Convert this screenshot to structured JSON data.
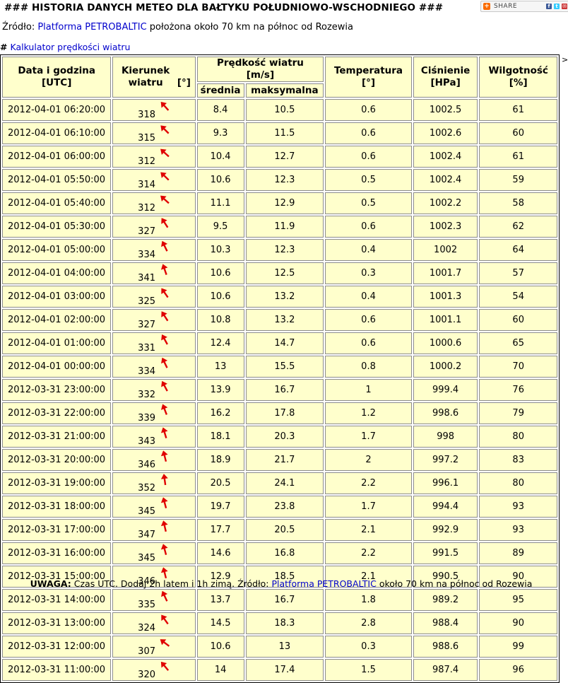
{
  "header": {
    "title": "### HISTORIA DANYCH METEO DLA BAŁTYKU POŁUDNIOWO-WSCHODNIEGO ###",
    "share_label": "SHARE"
  },
  "source": {
    "prefix": "Źródło:",
    "link": "Platforma PETROBALTIC",
    "suffix": "położona około 70 km na północ od Rozewia"
  },
  "calculator": {
    "hash": "#",
    "link": "Kalkulator prędkości wiatru"
  },
  "table": {
    "headers": {
      "datetime": "Data i godzina",
      "datetime_unit": "[UTC]",
      "direction": "Kierunek wiatru",
      "direction_unit": "[°]",
      "speed": "Prędkość wiatru",
      "speed_unit": "[m/s]",
      "speed_avg": "średnia",
      "speed_max": "maksymalna",
      "temperature": "Temperatura",
      "temperature_unit": "[°]",
      "pressure": "Ciśnienie",
      "pressure_unit": "[HPa]",
      "humidity": "Wilgotność",
      "humidity_unit": "[%]"
    },
    "rows": [
      {
        "dt": "2012-04-01 06:20:00",
        "dir": "318",
        "avg": "8.4",
        "max": "10.5",
        "temp": "0.6",
        "press": "1002.5",
        "hum": "61"
      },
      {
        "dt": "2012-04-01 06:10:00",
        "dir": "315",
        "avg": "9.3",
        "max": "11.5",
        "temp": "0.6",
        "press": "1002.6",
        "hum": "60"
      },
      {
        "dt": "2012-04-01 06:00:00",
        "dir": "312",
        "avg": "10.4",
        "max": "12.7",
        "temp": "0.6",
        "press": "1002.4",
        "hum": "61"
      },
      {
        "dt": "2012-04-01 05:50:00",
        "dir": "314",
        "avg": "10.6",
        "max": "12.3",
        "temp": "0.5",
        "press": "1002.4",
        "hum": "59"
      },
      {
        "dt": "2012-04-01 05:40:00",
        "dir": "312",
        "avg": "11.1",
        "max": "12.9",
        "temp": "0.5",
        "press": "1002.2",
        "hum": "58"
      },
      {
        "dt": "2012-04-01 05:30:00",
        "dir": "327",
        "avg": "9.5",
        "max": "11.9",
        "temp": "0.6",
        "press": "1002.3",
        "hum": "62"
      },
      {
        "dt": "2012-04-01 05:00:00",
        "dir": "334",
        "avg": "10.3",
        "max": "12.3",
        "temp": "0.4",
        "press": "1002",
        "hum": "64"
      },
      {
        "dt": "2012-04-01 04:00:00",
        "dir": "341",
        "avg": "10.6",
        "max": "12.5",
        "temp": "0.3",
        "press": "1001.7",
        "hum": "57"
      },
      {
        "dt": "2012-04-01 03:00:00",
        "dir": "325",
        "avg": "10.6",
        "max": "13.2",
        "temp": "0.4",
        "press": "1001.3",
        "hum": "54"
      },
      {
        "dt": "2012-04-01 02:00:00",
        "dir": "327",
        "avg": "10.8",
        "max": "13.2",
        "temp": "0.6",
        "press": "1001.1",
        "hum": "60"
      },
      {
        "dt": "2012-04-01 01:00:00",
        "dir": "331",
        "avg": "12.4",
        "max": "14.7",
        "temp": "0.6",
        "press": "1000.6",
        "hum": "65"
      },
      {
        "dt": "2012-04-01 00:00:00",
        "dir": "334",
        "avg": "13",
        "max": "15.5",
        "temp": "0.8",
        "press": "1000.2",
        "hum": "70"
      },
      {
        "dt": "2012-03-31 23:00:00",
        "dir": "332",
        "avg": "13.9",
        "max": "16.7",
        "temp": "1",
        "press": "999.4",
        "hum": "76"
      },
      {
        "dt": "2012-03-31 22:00:00",
        "dir": "339",
        "avg": "16.2",
        "max": "17.8",
        "temp": "1.2",
        "press": "998.6",
        "hum": "79"
      },
      {
        "dt": "2012-03-31 21:00:00",
        "dir": "343",
        "avg": "18.1",
        "max": "20.3",
        "temp": "1.7",
        "press": "998",
        "hum": "80"
      },
      {
        "dt": "2012-03-31 20:00:00",
        "dir": "346",
        "avg": "18.9",
        "max": "21.7",
        "temp": "2",
        "press": "997.2",
        "hum": "83"
      },
      {
        "dt": "2012-03-31 19:00:00",
        "dir": "352",
        "avg": "20.5",
        "max": "24.1",
        "temp": "2.2",
        "press": "996.1",
        "hum": "80"
      },
      {
        "dt": "2012-03-31 18:00:00",
        "dir": "345",
        "avg": "19.7",
        "max": "23.8",
        "temp": "1.7",
        "press": "994.4",
        "hum": "93"
      },
      {
        "dt": "2012-03-31 17:00:00",
        "dir": "347",
        "avg": "17.7",
        "max": "20.5",
        "temp": "2.1",
        "press": "992.9",
        "hum": "93"
      },
      {
        "dt": "2012-03-31 16:00:00",
        "dir": "345",
        "avg": "14.6",
        "max": "16.8",
        "temp": "2.2",
        "press": "991.5",
        "hum": "89"
      },
      {
        "dt": "2012-03-31 15:00:00",
        "dir": "346",
        "avg": "12.9",
        "max": "18.5",
        "temp": "2.1",
        "press": "990.5",
        "hum": "90"
      },
      {
        "dt": "2012-03-31 14:00:00",
        "dir": "335",
        "avg": "13.7",
        "max": "16.7",
        "temp": "1.8",
        "press": "989.2",
        "hum": "95"
      },
      {
        "dt": "2012-03-31 13:00:00",
        "dir": "324",
        "avg": "14.5",
        "max": "18.3",
        "temp": "2.8",
        "press": "988.4",
        "hum": "90"
      },
      {
        "dt": "2012-03-31 12:00:00",
        "dir": "307",
        "avg": "10.6",
        "max": "13",
        "temp": "0.3",
        "press": "988.6",
        "hum": "99"
      },
      {
        "dt": "2012-03-31 11:00:00",
        "dir": "320",
        "avg": "14",
        "max": "17.4",
        "temp": "1.5",
        "press": "987.4",
        "hum": "96"
      }
    ]
  },
  "footer": {
    "label": "UWAGA:",
    "text": "Czas UTC. Dodaj 2h latem i 1h zimą. Źródło:",
    "link": "Platforma PETROBALTIC",
    "suffix": "około 70 km na północ od Rozewia"
  },
  "colors": {
    "cell_bg": "#ffffcc",
    "link": "#0000cc",
    "arrow": "#e00000"
  },
  "icons": {
    "direction": "arrow-icon"
  }
}
